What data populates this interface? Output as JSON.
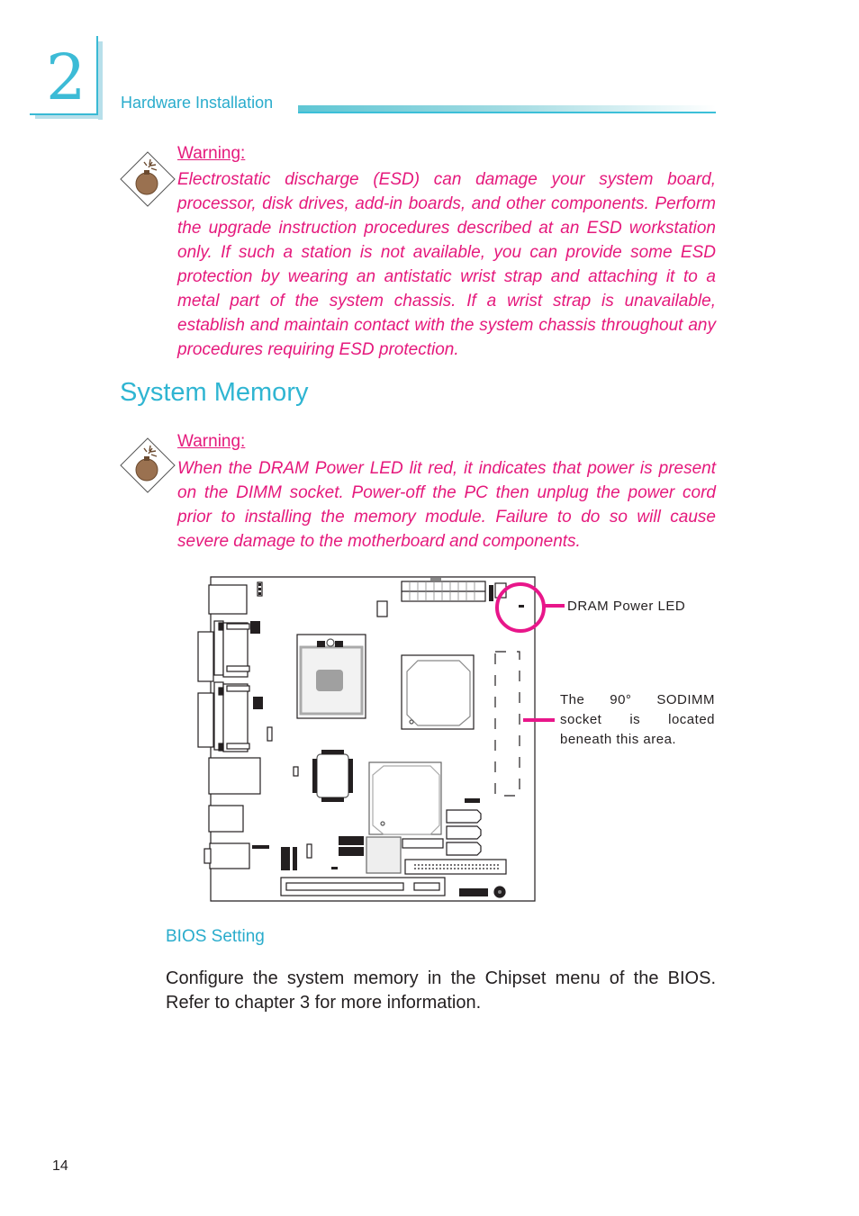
{
  "header": {
    "chapter_number": "2",
    "section_title": "Hardware Installation"
  },
  "warnings": [
    {
      "icon": "bomb-icon",
      "title": "Warning:",
      "text": "Electrostatic discharge (ESD) can damage your system board, processor, disk drives, add-in boards, and other components. Perform the upgrade instruction procedures described at an ESD workstation only. If such a station is not available, you can provide some ESD protection by wearing an antistatic wrist strap and attaching it to a metal part of the system chassis. If a wrist strap is unavailable, establish and maintain contact with the system chassis throughout any procedures requiring ESD protection."
    },
    {
      "icon": "bomb-icon",
      "title": "Warning:",
      "text": "When the DRAM Power LED lit red, it indicates that power is present on the DIMM socket. Power-off the PC then unplug the power cord prior to installing the memory module. Failure to do so will cause severe damage to the motherboard and components."
    }
  ],
  "section": {
    "title": "System Memory"
  },
  "diagram": {
    "callouts": {
      "dram_led": "DRAM Power LED",
      "sodimm_lines": [
        "The 90° SODIMM",
        "socket is located",
        "beneath this area."
      ]
    }
  },
  "bios": {
    "heading": "BIOS Setting",
    "text": "Configure the system memory in the Chipset menu of the BIOS. Refer to chapter 3 for more information."
  },
  "footer": {
    "page_number": "14"
  },
  "colors": {
    "accent_cyan": "#3cbbd6",
    "warning_pink": "#e5197c",
    "callout_magenta": "#e8168a"
  }
}
